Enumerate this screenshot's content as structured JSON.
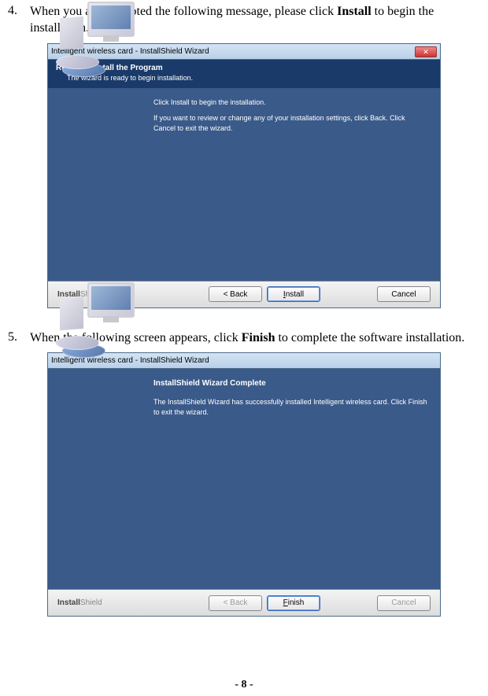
{
  "steps": {
    "s4": {
      "num": "4.",
      "text_before": "When you are prompted the following message, please click ",
      "bold": "Install",
      "text_after": " to begin the installation."
    },
    "s5": {
      "num": "5.",
      "text_before": "When the following screen appears, click ",
      "bold": "Finish",
      "text_after": " to complete the software installation."
    }
  },
  "wizard1": {
    "title": "Intelligent wireless card - InstallShield Wizard",
    "header_title": "Ready to Install the Program",
    "header_sub": "The wizard is ready to begin installation.",
    "body_line1": "Click Install to begin the installation.",
    "body_line2": "If you want to review or change any of your installation settings, click Back. Click Cancel to exit the wizard.",
    "logo_bold": "Install",
    "logo_light": "Shield",
    "btn_back": "< Back",
    "btn_install": "Install",
    "btn_cancel": "Cancel"
  },
  "wizard2": {
    "title": "Intelligent wireless card - InstallShield Wizard",
    "content_title": "InstallShield Wizard Complete",
    "content_body": "The InstallShield Wizard has successfully installed Intelligent wireless card.  Click Finish to exit the wizard.",
    "logo_bold": "Install",
    "logo_light": "Shield",
    "btn_back": "< Back",
    "btn_finish": "Finish",
    "btn_cancel": "Cancel"
  },
  "page_number": "- 8 -"
}
